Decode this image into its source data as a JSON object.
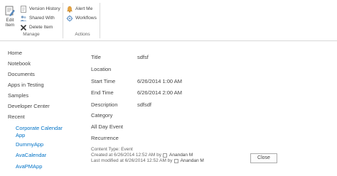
{
  "ribbon": {
    "manage": {
      "label": "Manage",
      "edit_item": "Edit Item",
      "version_history": "Version History",
      "shared_with": "Shared With",
      "delete_item": "Delete Item"
    },
    "actions": {
      "label": "Actions",
      "alert_me": "Alert Me",
      "workflows": "Workflows"
    }
  },
  "nav": {
    "items": [
      "Home",
      "Notebook",
      "Documents",
      "Apps in Testing",
      "Samples",
      "Developer Center",
      "Recent"
    ],
    "recent": [
      "Corporate Calendar App",
      "DummyApp",
      "AvaCalendar",
      "AvaPMApp"
    ]
  },
  "item": {
    "fields": [
      {
        "label": "Title",
        "value": "sdfsf"
      },
      {
        "label": "Location",
        "value": ""
      },
      {
        "label": "Start Time",
        "value": "6/26/2014 1:00 AM"
      },
      {
        "label": "End Time",
        "value": "6/26/2014 2:00 AM"
      },
      {
        "label": "Description",
        "value": "sdfsdf"
      },
      {
        "label": "Category",
        "value": ""
      },
      {
        "label": "All Day Event",
        "value": ""
      },
      {
        "label": "Recurrence",
        "value": ""
      }
    ],
    "content_type": "Content Type: Event",
    "created": "Created at 6/26/2014 12:52 AM  by",
    "created_by": "Anandan M",
    "modified": "Last modified at 6/26/2014 12:52 AM  by",
    "modified_by": "Anandan M"
  },
  "close_label": "Close",
  "colors": {
    "link": "#0072c6",
    "text": "#444444",
    "delete": "#333333",
    "alert": "#e8a33d"
  }
}
